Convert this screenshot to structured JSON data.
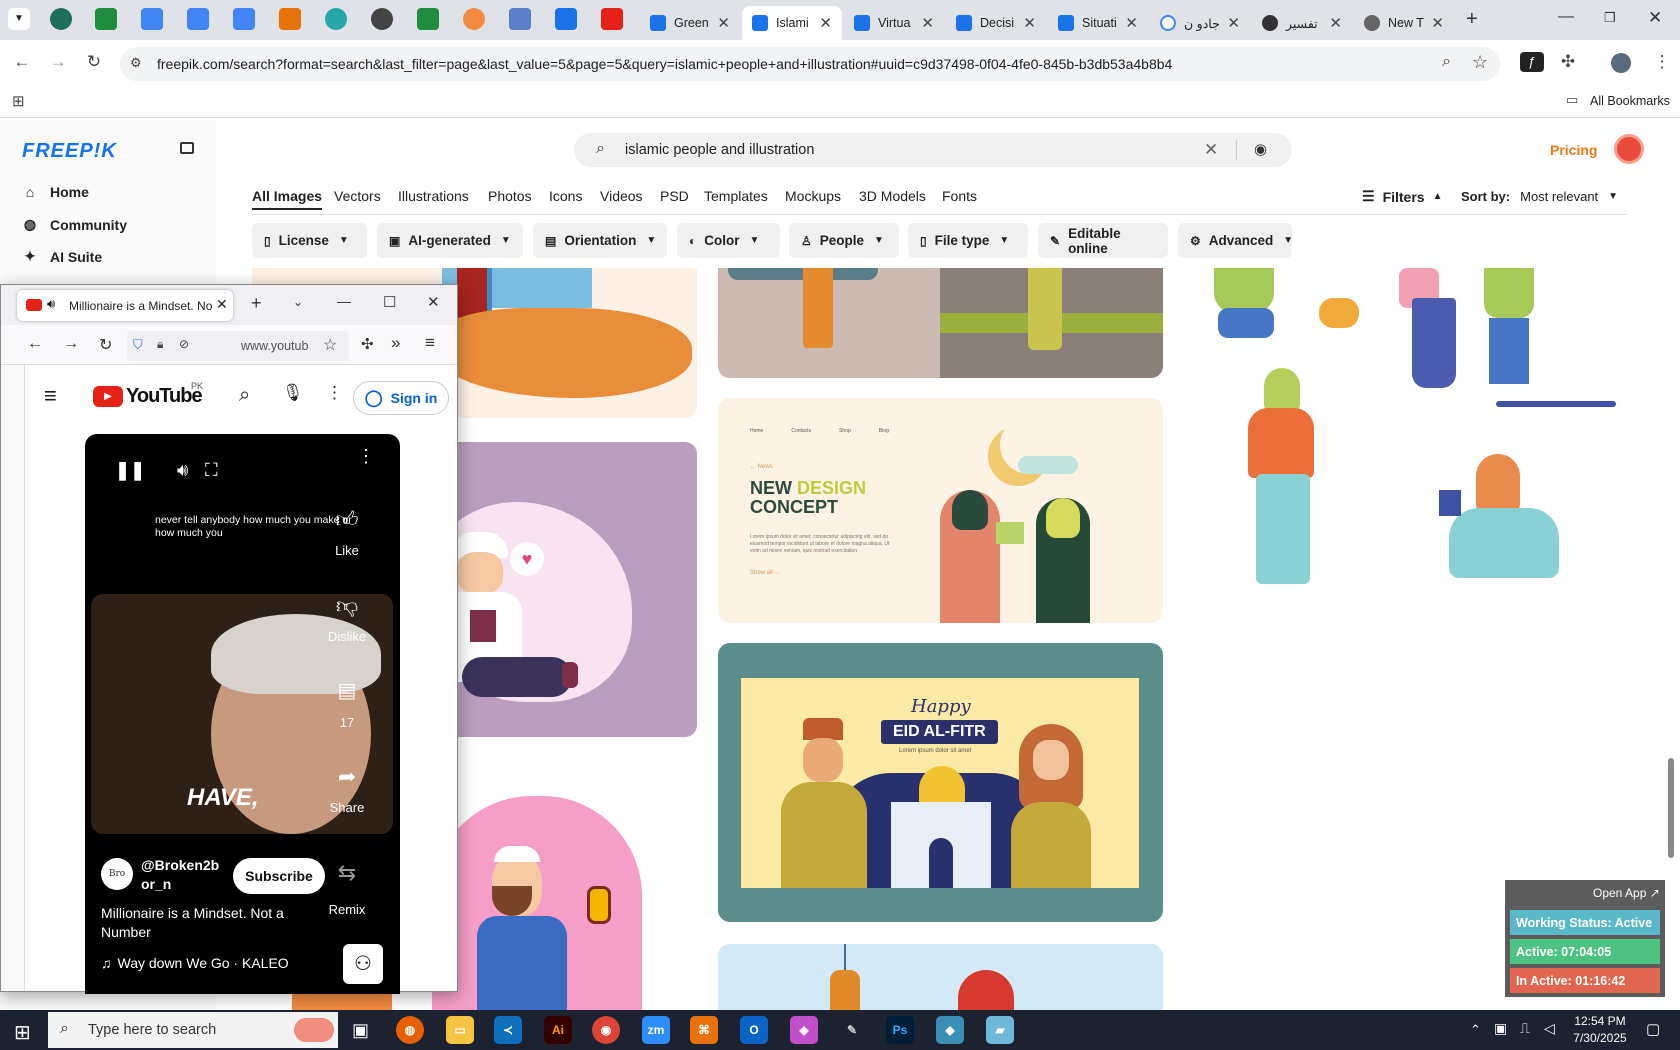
{
  "browser": {
    "tabs": [
      {
        "label": "Green",
        "color": "#1a73e8"
      },
      {
        "label": "Islami",
        "color": "#1a73e8",
        "active": true
      },
      {
        "label": "Virtua",
        "color": "#1a73e8"
      },
      {
        "label": "Decisi",
        "color": "#1a73e8"
      },
      {
        "label": "Situati",
        "color": "#1a73e8"
      },
      {
        "label": "جادو ن",
        "color": "#4285f4"
      },
      {
        "label": "تفسير",
        "color": "#333333"
      },
      {
        "label": "New T",
        "color": "#666666"
      }
    ],
    "url": "freepik.com/search?format=search&last_filter=page&last_value=5&page=5&query=islamic+people+and+illustration#uuid=c9d37498-0f04-4fe0-845b-b3db53a4b8b4",
    "all_bookmarks": "All Bookmarks"
  },
  "freepik": {
    "logo": "FREEP!K",
    "nav": [
      "Home",
      "Community",
      "AI Suite"
    ],
    "search_query": "islamic people and illustration",
    "pricing": "Pricing",
    "categories": [
      "All Images",
      "Vectors",
      "Illustrations",
      "Photos",
      "Icons",
      "Videos",
      "PSD",
      "Templates",
      "Mockups",
      "3D Models",
      "Fonts"
    ],
    "filters_label": "Filters",
    "sort_label": "Sort by:",
    "sort_value": "Most relevant",
    "chips": [
      "License",
      "AI-generated",
      "Orientation",
      "Color",
      "People",
      "File type",
      "Editable online",
      "Advanced"
    ],
    "cards": {
      "landing_nav": [
        "Home",
        "Contacts",
        "Shop",
        "Blog"
      ],
      "landing_kicker": "← News",
      "landing_title_1": "NEW ",
      "landing_title_2": "DESIGN",
      "landing_title_3": "CONCEPT",
      "landing_body": "Lorem ipsum dolor sit amet, consectetur adipiscing elit, sed do eiusmod tempor incididunt ut labore et dolore magna aliqua. Ut enim ad minim veniam, quis nostrud exercitation",
      "landing_cta": "Show all →",
      "eid_happy": "Happy",
      "eid_title": "EID AL-FITR",
      "eid_sub": "Lorem ipsum dolor sit amet"
    }
  },
  "firefox": {
    "tab_title": "Millionaire is a Mindset. No",
    "url": "www.youtub",
    "youtube_logo": "YouTube",
    "country": "PK",
    "sign_in": "Sign in",
    "caption": "never tell anybody how much you make or how much you",
    "overlay_text": "HAVE,",
    "like": "Like",
    "dislike": "Dislike",
    "comments": "17",
    "share": "Share",
    "channel": "@Broken2bor_n",
    "avatar_text": "Bro",
    "subscribe": "Subscribe",
    "remix": "Remix",
    "title": "Millionaire is a Mindset. Not a Number",
    "sound": "Way down We Go · KALEO"
  },
  "tracker": {
    "open_app": "Open App ↗",
    "working": "Working Status: Active",
    "active": "Active: 07:04:05",
    "inactive": "In Active: 01:16:42"
  },
  "taskbar": {
    "search_placeholder": "Type here to search",
    "time": "12:54 PM",
    "date": "7/30/2025"
  }
}
